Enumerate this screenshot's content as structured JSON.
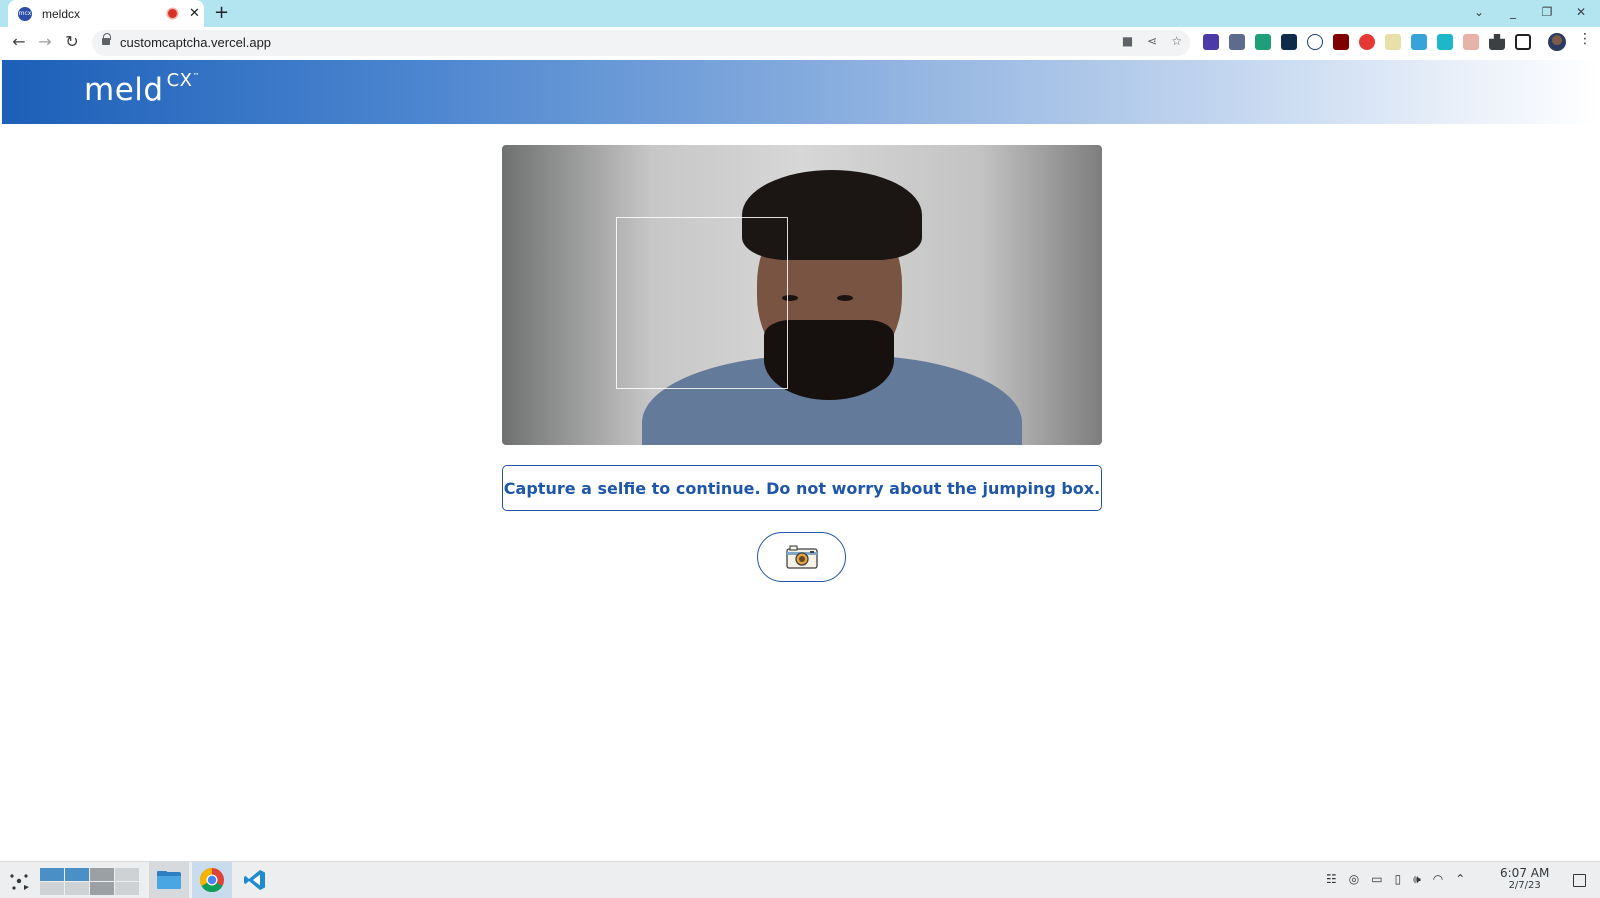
{
  "browser": {
    "tab": {
      "title": "meldcx",
      "favicon_label": "mcx"
    },
    "new_tab_icon": "plus-icon",
    "url": "customcaptcha.vercel.app",
    "colors": {
      "tabstrip": "#b3e5f0",
      "omnibox": "#f1f3f4"
    }
  },
  "header": {
    "logo_main": "meld",
    "logo_sub": "CX",
    "logo_tm": "™",
    "colors": {
      "gradient_start": "#1c5fb8",
      "gradient_end": "#ffffff"
    }
  },
  "main": {
    "instruction": "Capture a selfie to continue. Do not worry about the jumping box.",
    "capture_icon": "camera-icon",
    "accent_color": "#1f56a8"
  },
  "taskbar": {
    "clock_time": "6:07 AM",
    "clock_date": "2/7/23"
  }
}
